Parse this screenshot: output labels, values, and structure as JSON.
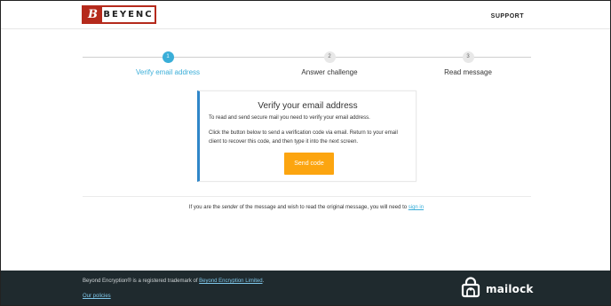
{
  "header": {
    "logo_mark": "B",
    "logo_text": "BEYENC",
    "support_label": "SUPPORT"
  },
  "steps": [
    {
      "number": "1",
      "label": "Verify email address",
      "active": true
    },
    {
      "number": "2",
      "label": "Answer challenge",
      "active": false
    },
    {
      "number": "3",
      "label": "Read message",
      "active": false
    }
  ],
  "card": {
    "title": "Verify your email address",
    "paragraph1": "To read and send secure mail you need to verify your email address.",
    "paragraph2": "Click the button below to send a verification code via email. Return to your email client to recover this code, and then type it into the next screen.",
    "send_button": "Send code"
  },
  "sender_note": {
    "prefix": "If you are the ",
    "emphasis": "sender",
    "middle": " of the message and wish to read the original message, you will need to ",
    "link": "sign in"
  },
  "footer": {
    "trademark_prefix": "Beyond Encryption® is a registered trademark of ",
    "trademark_link": "Beyond Encryption Limited",
    "trademark_suffix": ".",
    "policies_link": "Our policies",
    "brand": "mailock"
  },
  "colors": {
    "accent_blue": "#3aaed8",
    "card_border": "#2f86c9",
    "button_orange": "#fca510",
    "logo_red": "#b52a1c",
    "footer_bg": "#1f2a2e"
  }
}
